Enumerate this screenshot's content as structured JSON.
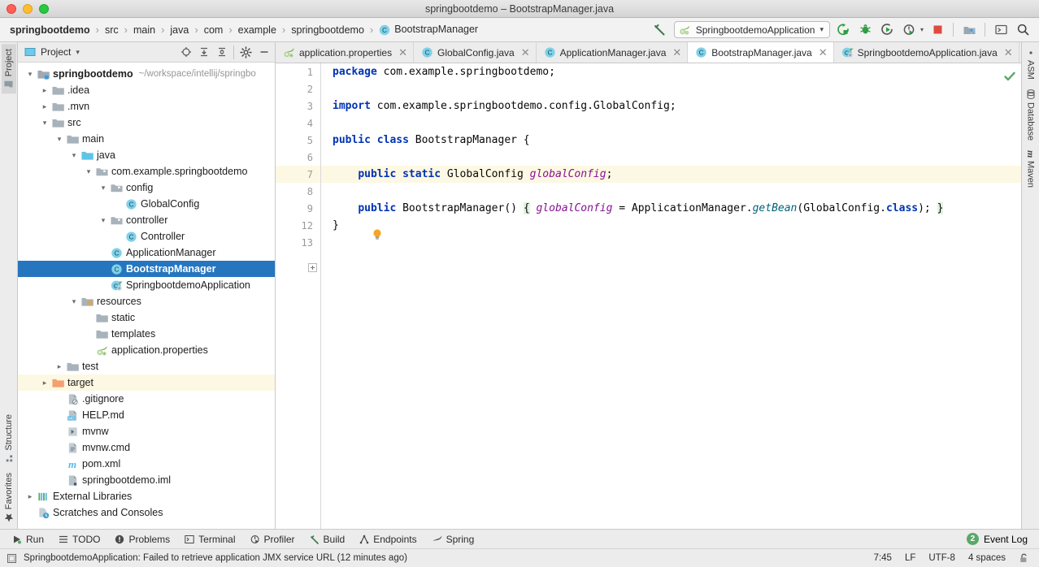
{
  "window": {
    "title": "springbootdemo – BootstrapManager.java",
    "traffic_lights": [
      "close-red",
      "minimize-yellow",
      "zoom-green"
    ]
  },
  "navbar": {
    "breadcrumbs": [
      {
        "label": "springbootdemo",
        "bold": true,
        "icon": ""
      },
      {
        "label": "src",
        "bold": false,
        "icon": ""
      },
      {
        "label": "main",
        "bold": false,
        "icon": ""
      },
      {
        "label": "java",
        "bold": false,
        "icon": ""
      },
      {
        "label": "com",
        "bold": false,
        "icon": ""
      },
      {
        "label": "example",
        "bold": false,
        "icon": ""
      },
      {
        "label": "springbootdemo",
        "bold": false,
        "icon": ""
      },
      {
        "label": "BootstrapManager",
        "bold": false,
        "icon": "class-icon"
      }
    ],
    "separator": "›",
    "run_config": {
      "label": "SpringbootdemoApplication",
      "icon": "spring-boot-icon",
      "chevron": "▾"
    },
    "buttons": [
      {
        "name": "build-hammer-icon",
        "label": "Build"
      },
      {
        "name": "run-icon",
        "label": "Run"
      },
      {
        "name": "debug-icon",
        "label": "Debug"
      },
      {
        "name": "run-with-coverage-icon",
        "label": "Run with Coverage"
      },
      {
        "name": "profile-icon",
        "label": "Profile"
      },
      {
        "name": "stop-icon",
        "label": "Stop"
      },
      {
        "name": "project-structure-icon",
        "label": "Project Structure"
      },
      {
        "name": "terminal-icon",
        "label": "Terminal"
      },
      {
        "name": "search-everywhere-icon",
        "label": "Search Everywhere"
      }
    ]
  },
  "left_stripe": {
    "top": [
      {
        "label": "Project",
        "icon": "project-icon",
        "active": true
      }
    ],
    "bottom": [
      {
        "label": "Structure",
        "icon": "structure-icon",
        "active": false
      },
      {
        "label": "Favorites",
        "icon": "star-icon",
        "active": false
      }
    ]
  },
  "right_stripe": {
    "items": [
      {
        "label": "ASM",
        "icon": "asm-icon"
      },
      {
        "label": "Database",
        "icon": "database-icon"
      },
      {
        "label": "Maven",
        "icon": "maven-icon"
      }
    ]
  },
  "project_panel": {
    "title": "Project",
    "chevron": "▾",
    "header_buttons": [
      {
        "name": "scroll-from-source-icon",
        "label": "Select Opened File"
      },
      {
        "name": "expand-all-icon",
        "label": "Expand All"
      },
      {
        "name": "collapse-all-icon",
        "label": "Collapse All"
      },
      {
        "name": "settings-gear-icon",
        "label": "Options"
      },
      {
        "name": "hide-panel-icon",
        "label": "Hide"
      }
    ],
    "tree": [
      {
        "indent": 0,
        "arrow": "▾",
        "icon": "module-folder-icon",
        "label": "springbootdemo",
        "bold": true,
        "path": "~/workspace/intellij/springbo",
        "selected": false,
        "highlight": false
      },
      {
        "indent": 1,
        "arrow": "▸",
        "icon": "folder-icon",
        "label": ".idea",
        "bold": false,
        "path": "",
        "selected": false,
        "highlight": false
      },
      {
        "indent": 1,
        "arrow": "▸",
        "icon": "folder-icon",
        "label": ".mvn",
        "bold": false,
        "path": "",
        "selected": false,
        "highlight": false
      },
      {
        "indent": 1,
        "arrow": "▾",
        "icon": "folder-icon",
        "label": "src",
        "bold": false,
        "path": "",
        "selected": false,
        "highlight": false
      },
      {
        "indent": 2,
        "arrow": "▾",
        "icon": "folder-icon",
        "label": "main",
        "bold": false,
        "path": "",
        "selected": false,
        "highlight": false
      },
      {
        "indent": 3,
        "arrow": "▾",
        "icon": "source-folder-icon",
        "label": "java",
        "bold": false,
        "path": "",
        "selected": false,
        "highlight": false
      },
      {
        "indent": 4,
        "arrow": "▾",
        "icon": "package-icon",
        "label": "com.example.springbootdemo",
        "bold": false,
        "path": "",
        "selected": false,
        "highlight": false
      },
      {
        "indent": 5,
        "arrow": "▾",
        "icon": "package-icon",
        "label": "config",
        "bold": false,
        "path": "",
        "selected": false,
        "highlight": false
      },
      {
        "indent": 6,
        "arrow": "",
        "icon": "class-icon",
        "label": "GlobalConfig",
        "bold": false,
        "path": "",
        "selected": false,
        "highlight": false
      },
      {
        "indent": 5,
        "arrow": "▾",
        "icon": "package-icon",
        "label": "controller",
        "bold": false,
        "path": "",
        "selected": false,
        "highlight": false
      },
      {
        "indent": 6,
        "arrow": "",
        "icon": "class-icon",
        "label": "Controller",
        "bold": false,
        "path": "",
        "selected": false,
        "highlight": false
      },
      {
        "indent": 5,
        "arrow": "",
        "icon": "class-icon",
        "label": "ApplicationManager",
        "bold": false,
        "path": "",
        "selected": false,
        "highlight": false
      },
      {
        "indent": 5,
        "arrow": "",
        "icon": "class-icon",
        "label": "BootstrapManager",
        "bold": true,
        "path": "",
        "selected": true,
        "highlight": false
      },
      {
        "indent": 5,
        "arrow": "",
        "icon": "spring-class-icon",
        "label": "SpringbootdemoApplication",
        "bold": false,
        "path": "",
        "selected": false,
        "highlight": false
      },
      {
        "indent": 3,
        "arrow": "▾",
        "icon": "resources-folder-icon",
        "label": "resources",
        "bold": false,
        "path": "",
        "selected": false,
        "highlight": false
      },
      {
        "indent": 4,
        "arrow": "",
        "icon": "folder-icon",
        "label": "static",
        "bold": false,
        "path": "",
        "selected": false,
        "highlight": false
      },
      {
        "indent": 4,
        "arrow": "",
        "icon": "folder-icon",
        "label": "templates",
        "bold": false,
        "path": "",
        "selected": false,
        "highlight": false
      },
      {
        "indent": 4,
        "arrow": "",
        "icon": "spring-boot-icon",
        "label": "application.properties",
        "bold": false,
        "path": "",
        "selected": false,
        "highlight": false
      },
      {
        "indent": 2,
        "arrow": "▸",
        "icon": "folder-icon",
        "label": "test",
        "bold": false,
        "path": "",
        "selected": false,
        "highlight": false
      },
      {
        "indent": 1,
        "arrow": "▸",
        "icon": "target-folder-icon",
        "label": "target",
        "bold": false,
        "path": "",
        "selected": false,
        "highlight": true
      },
      {
        "indent": 2,
        "arrow": "",
        "icon": "gitignore-file-icon",
        "label": ".gitignore",
        "bold": false,
        "path": "",
        "selected": false,
        "highlight": false
      },
      {
        "indent": 2,
        "arrow": "",
        "icon": "markdown-file-icon",
        "label": "HELP.md",
        "bold": false,
        "path": "",
        "selected": false,
        "highlight": false
      },
      {
        "indent": 2,
        "arrow": "",
        "icon": "script-file-icon",
        "label": "mvnw",
        "bold": false,
        "path": "",
        "selected": false,
        "highlight": false
      },
      {
        "indent": 2,
        "arrow": "",
        "icon": "text-file-icon",
        "label": "mvnw.cmd",
        "bold": false,
        "path": "",
        "selected": false,
        "highlight": false
      },
      {
        "indent": 2,
        "arrow": "",
        "icon": "maven-pom-icon",
        "label": "pom.xml",
        "bold": false,
        "path": "",
        "selected": false,
        "highlight": false
      },
      {
        "indent": 2,
        "arrow": "",
        "icon": "iml-file-icon",
        "label": "springbootdemo.iml",
        "bold": false,
        "path": "",
        "selected": false,
        "highlight": false
      },
      {
        "indent": 0,
        "arrow": "▸",
        "icon": "libraries-icon",
        "label": "External Libraries",
        "bold": false,
        "path": "",
        "selected": false,
        "highlight": false
      },
      {
        "indent": 0,
        "arrow": "",
        "icon": "scratches-icon",
        "label": "Scratches and Consoles",
        "bold": false,
        "path": "",
        "selected": false,
        "highlight": false
      }
    ]
  },
  "editor": {
    "tabs": [
      {
        "label": "application.properties",
        "icon": "spring-boot-icon",
        "active": false,
        "close": "✕"
      },
      {
        "label": "GlobalConfig.java",
        "icon": "class-icon",
        "active": false,
        "close": "✕"
      },
      {
        "label": "ApplicationManager.java",
        "icon": "class-icon",
        "active": false,
        "close": "✕"
      },
      {
        "label": "BootstrapManager.java",
        "icon": "class-icon",
        "active": true,
        "close": "✕"
      },
      {
        "label": "SpringbootdemoApplication.java",
        "icon": "spring-class-icon",
        "active": false,
        "close": "✕"
      }
    ],
    "line_numbers": [
      "1",
      "2",
      "3",
      "4",
      "5",
      "6",
      "7",
      "8",
      "9",
      "12",
      "13"
    ],
    "current_line_index": 6,
    "inspection_status": "ok-check-icon",
    "code_lines": [
      {
        "n": "1",
        "tokens": [
          {
            "t": "package",
            "c": "kw"
          },
          {
            "t": " com.example.springbootdemo;",
            "c": "plain"
          }
        ]
      },
      {
        "n": "2",
        "tokens": []
      },
      {
        "n": "3",
        "tokens": [
          {
            "t": "import",
            "c": "kw"
          },
          {
            "t": " com.example.springbootdemo.config.GlobalConfig;",
            "c": "plain"
          }
        ]
      },
      {
        "n": "4",
        "tokens": []
      },
      {
        "n": "5",
        "tokens": [
          {
            "t": "public class",
            "c": "kw"
          },
          {
            "t": " BootstrapManager {",
            "c": "plain"
          }
        ]
      },
      {
        "n": "6",
        "tokens": []
      },
      {
        "n": "7",
        "tokens": [
          {
            "t": "    ",
            "c": "plain"
          },
          {
            "t": "public static",
            "c": "kw"
          },
          {
            "t": " GlobalConfig ",
            "c": "plain"
          },
          {
            "t": "globalConfig",
            "c": "fld"
          },
          {
            "t": ";",
            "c": "plain"
          }
        ]
      },
      {
        "n": "8",
        "tokens": []
      },
      {
        "n": "9",
        "tokens": [
          {
            "t": "    ",
            "c": "plain"
          },
          {
            "t": "public",
            "c": "kw"
          },
          {
            "t": " BootstrapManager() ",
            "c": "plain"
          },
          {
            "t": "{",
            "c": "brace-hl"
          },
          {
            "t": " ",
            "c": "plain"
          },
          {
            "t": "globalConfig",
            "c": "fld"
          },
          {
            "t": " = ApplicationManager.",
            "c": "plain"
          },
          {
            "t": "getBean",
            "c": "mth"
          },
          {
            "t": "(GlobalConfig.",
            "c": "plain"
          },
          {
            "t": "class",
            "c": "kw"
          },
          {
            "t": "); ",
            "c": "plain"
          },
          {
            "t": "}",
            "c": "brace-hl"
          }
        ]
      },
      {
        "n": "12",
        "tokens": [
          {
            "t": "}",
            "c": "plain"
          }
        ]
      },
      {
        "n": "13",
        "tokens": []
      }
    ]
  },
  "toolwindow_bar": {
    "buttons": [
      {
        "label": "Run",
        "icon": "run-icon"
      },
      {
        "label": "TODO",
        "icon": "todo-icon"
      },
      {
        "label": "Problems",
        "icon": "problems-icon"
      },
      {
        "label": "Terminal",
        "icon": "terminal-icon"
      },
      {
        "label": "Profiler",
        "icon": "profiler-icon"
      },
      {
        "label": "Build",
        "icon": "build-hammer-icon"
      },
      {
        "label": "Endpoints",
        "icon": "endpoints-icon"
      },
      {
        "label": "Spring",
        "icon": "spring-leaf-icon"
      }
    ],
    "event_log": {
      "label": "Event Log",
      "count": "2"
    }
  },
  "statusbar": {
    "message": "SpringbootdemoApplication: Failed to retrieve application JMX service URL (12 minutes ago)",
    "message_icon": "console-icon",
    "caret_position": "7:45",
    "line_separator": "LF",
    "encoding": "UTF-8",
    "indent": "4 spaces",
    "lock_icon": "unlocked-icon"
  },
  "colors": {
    "selection_blue": "#2675bf",
    "highlight_yellow": "#fdf8e3",
    "keyword_blue": "#0033b3",
    "field_purple": "#871094",
    "method_teal": "#00627a",
    "green_accent": "#59a869",
    "chrome_gray": "#ececec"
  }
}
